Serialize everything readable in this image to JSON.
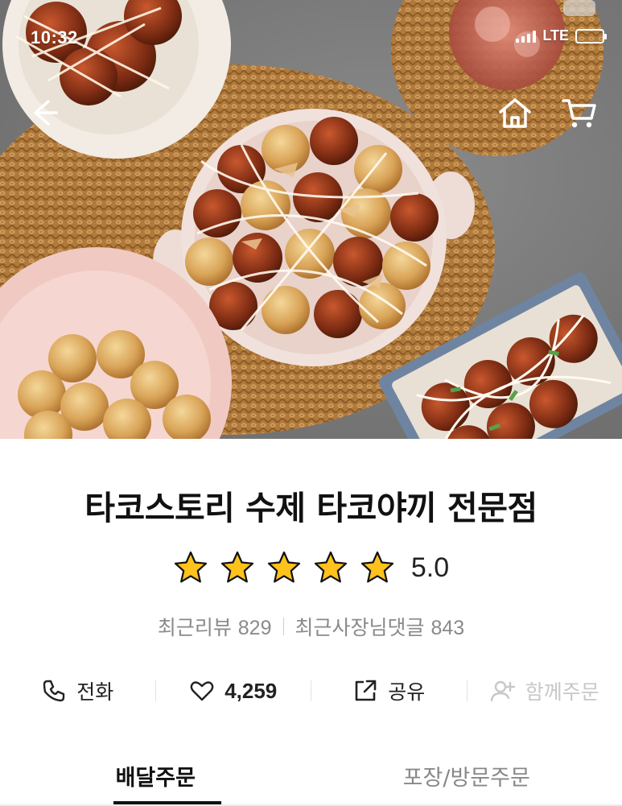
{
  "status_bar": {
    "time": "10:32",
    "network": "LTE",
    "battery_color": "#4cd964"
  },
  "top_nav": {
    "back_icon": "arrow-left-icon",
    "home_icon": "home-icon",
    "cart_icon": "cart-icon"
  },
  "store": {
    "name": "타코스토리 수제 타코야끼 전문점",
    "rating": "5.0",
    "stars_filled": 5,
    "stars_total": 5,
    "star_color": "#ffc21c"
  },
  "reviews": {
    "recent_reviews_label": "최근리뷰",
    "recent_reviews_count": "829",
    "owner_replies_label": "최근사장님댓글",
    "owner_replies_count": "843"
  },
  "actions": {
    "call": {
      "label": "전화",
      "icon": "phone-icon"
    },
    "like": {
      "count": "4,259",
      "icon": "heart-icon"
    },
    "share": {
      "label": "공유",
      "icon": "share-icon"
    },
    "group_order": {
      "label": "함께주문",
      "icon": "add-user-icon"
    }
  },
  "tabs": [
    {
      "label": "배달주문",
      "active": true
    },
    {
      "label": "포장/방문주문",
      "active": false
    }
  ]
}
